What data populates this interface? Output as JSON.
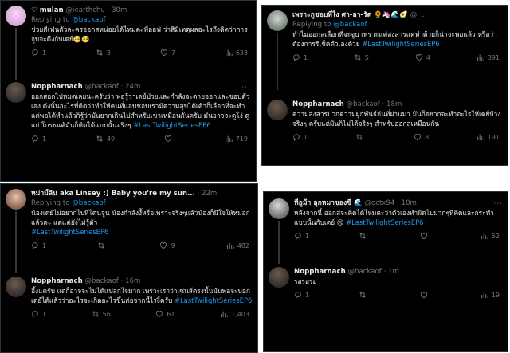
{
  "icons": {
    "reply": "reply-icon",
    "retweet": "retweet-icon",
    "like": "heart-icon",
    "views": "views-bar-icon",
    "more": "more-icon"
  },
  "colors": {
    "background": "#000000",
    "link": "#1d9bf0",
    "muted": "#71767b",
    "text": "#e7e9ea"
  },
  "panels": [
    {
      "tweets": [
        {
          "name": "♡ mulan",
          "handle": "@iearthchu",
          "time": "30m",
          "replying_label": "Replying to",
          "replying_handle": "@backaof",
          "text": "ช่วยดีเฟนตัวละครออกสหน่อยได้ไหมคะพี่ออฟ ว่าสิมีเหตุผลอะไรถึงคิดว่าการจูบจะดึงกับเดย์🥺🥺",
          "tags": "",
          "replies": "1",
          "retweets": "3",
          "likes": "7",
          "views": "633"
        },
        {
          "name": "Noppharnach",
          "handle": "@backaof",
          "time": "24m",
          "replying_label": "",
          "replying_handle": "",
          "text": "ออกสอกไปหมดเลยนะครับว่า พอรู้ว่าเดย์ป่วยและกำลังจะตายออกและชอบตัวเอง ดังนั้นอะไรที่คิดว่าทำให้คนที่แอบชอบเรามีความสุขได้เค้าก็เลือกที่จะทำ แต่พอได้ทำแล้วก็รู้ว่ามันยากเกินไปสำหรับเขาเหมือนกันครับ มันอาจจะดูโง่ ดูแย่ โกรธแค้มันก็คิดได้แบบนั้นจริงๆ ",
          "tags": "#LastTwilightSeriesEP6",
          "replies": "1",
          "retweets": "49",
          "likes": "",
          "views": "719"
        }
      ]
    },
    {
      "tweets": [
        {
          "name": "เพราะกูชอบที่ไง ศา-ลา-รัด 🌻🦄🌊🥑",
          "handle": "@_...",
          "time": "",
          "replying_label": "Replying to",
          "replying_handle": "@backaof",
          "text": "ทำไมออกสเลือกที่จะจูบ เพราะแค่สงสารแค่ทำด้วยก็น่าจะพอแล้ว หรือว่าต้องการรีเช็คตัวเองด้วย ",
          "tags": "#LastTwilightSeriesEP6",
          "replies": "1",
          "retweets": "5",
          "likes": "4",
          "views": "391"
        },
        {
          "name": "Noppharnach",
          "handle": "@backaof",
          "time": "18m",
          "replying_label": "",
          "replying_handle": "",
          "text": "ความสงสารบวกความผูกพันธ์กันที่ผ่านมา มันก็อยากจะทำอะไรให้เดย์บ้างจริงๆ ครับแต่มันก็ไม่ได้จริงๆ สำหรับออกสเหมือนกัน",
          "tags": "",
          "replies": "1",
          "retweets": "",
          "likes": "8",
          "views": "191"
        }
      ]
    },
    {
      "tweets": [
        {
          "name": "หม่ามี้ลิน aka Linsey :) Baby you're my sun...",
          "handle": "",
          "time": "22m",
          "replying_label": "Replying to",
          "replying_handle": "@backaof",
          "text": "น้องเดย์ไม่อยากไปที่ไดนจูน น้องกำลังงี้หรือเพราะจริงๆแล้วน้องก็มีใจให้หมอกแล้วคะ แต่แค่ยังไม่รู้ตัว",
          "tags": "#LastTwilightSeriesEP6",
          "replies": "1",
          "retweets": "",
          "likes": "9",
          "views": "482"
        },
        {
          "name": "Noppharnach",
          "handle": "@backaof",
          "time": "16m",
          "replying_label": "",
          "replying_handle": "",
          "text": "อึ้งแครับ แต่ก็อาจจะไม่ได้แปลกไจมาก เพราะเราว่าเซนส์ตรงนั้นมันพอจะบอกเดย์ได้แล้วว่าอะไรจะเกิดอะไรขึ้นต่อจากนี้ไรงี้ครับ ",
          "tags": "#LastTwilightSeriesEP6",
          "replies": "1",
          "retweets": "56",
          "likes": "61",
          "views": "1,403"
        }
      ]
    },
    {
      "tweets": [
        {
          "name": "ที่อูม้า ลูกหมาของซี 🌊",
          "handle": "@octx94",
          "time": "10m",
          "replying_label": "",
          "replying_handle": "",
          "text": "หลังจากนี้ ออกสจะคิดได้ไหมคะว่าตัวเองทำผิดไปมากๆที่คิดและกระทำแบบนั้นกับเดย์ 😥 ",
          "tags": "#LastTwilightSeriesEP6",
          "replies": "1",
          "retweets": "",
          "likes": "",
          "views": "52"
        },
        {
          "name": "Noppharnach",
          "handle": "@backaof",
          "time": "1m",
          "replying_label": "",
          "replying_handle": "",
          "text": "รอรอรอ",
          "tags": "",
          "replies": "1",
          "retweets": "",
          "likes": "",
          "views": "19"
        }
      ]
    }
  ]
}
